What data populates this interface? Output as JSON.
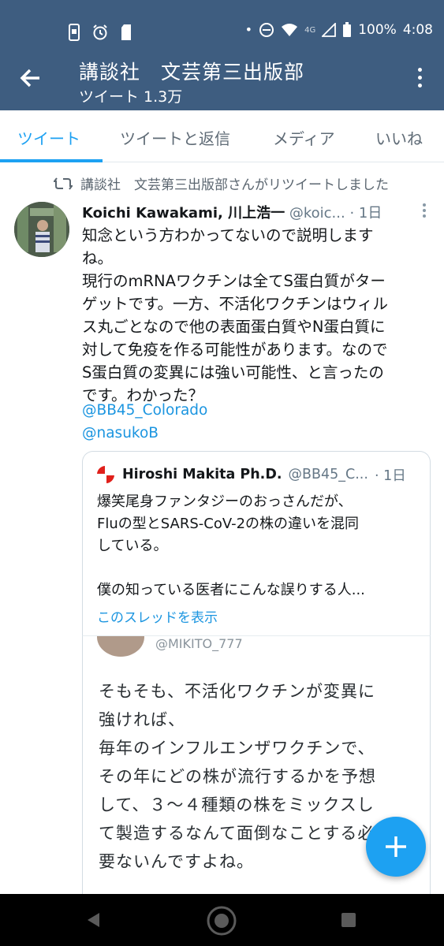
{
  "status_bar": {
    "network": "4G",
    "battery": "100%",
    "time": "4:08"
  },
  "header": {
    "title": "講談社　文芸第三出版部",
    "subtitle": "ツイート 1.3万"
  },
  "tabs": [
    {
      "label": "ツイート"
    },
    {
      "label": "ツイートと返信"
    },
    {
      "label": "メディア"
    },
    {
      "label": "いいね"
    }
  ],
  "retweet": {
    "text": "講談社　文芸第三出版部さんがリツイートしました"
  },
  "tweet": {
    "author": "Koichi Kawakami, 川上浩一",
    "handle": "@koic...",
    "time": "· 1日",
    "lines": [
      "知念という方わかってないので説明します",
      "ね。",
      "現行のmRNAワクチンは全てS蛋白質がター",
      "ゲットです。一方、不活化ワクチンはウィル",
      "ス丸ごとなので他の表面蛋白質やN蛋白質に",
      "対して免疫を作る可能性があります。なので",
      "S蛋白質の変異には強い可能性、と言ったの",
      "です。わかった？"
    ],
    "mentions": [
      "@BB45_Colorado",
      "@nasukoB"
    ]
  },
  "quoted": {
    "author": "Hiroshi Makita Ph.D.",
    "handle": "@BB45_C...",
    "time": "· 1日",
    "lines": [
      "爆笑尾身ファンタジーのおっさんだが、",
      "Fluの型とSARS-CoV-2の株の違いを混同",
      "している。",
      "",
      "僕の知っている医者にこんな誤りする人..."
    ],
    "thread_link": "このスレッドを表示"
  },
  "embedded_image": {
    "handle": "@MIKITO_777",
    "lines": [
      "そもそも、不活化ワクチンが変異に",
      "強ければ、",
      "毎年のインフルエンザワクチンで、",
      "その年にどの株が流行するかを予想",
      "して、３～４種類の株をミックスし",
      "て製造するなんて面倒なことする必",
      "要ないんですよね。"
    ]
  },
  "colors": {
    "header_bg": "#3e5d80",
    "accent": "#1da1f2",
    "link": "#1b95e0"
  }
}
